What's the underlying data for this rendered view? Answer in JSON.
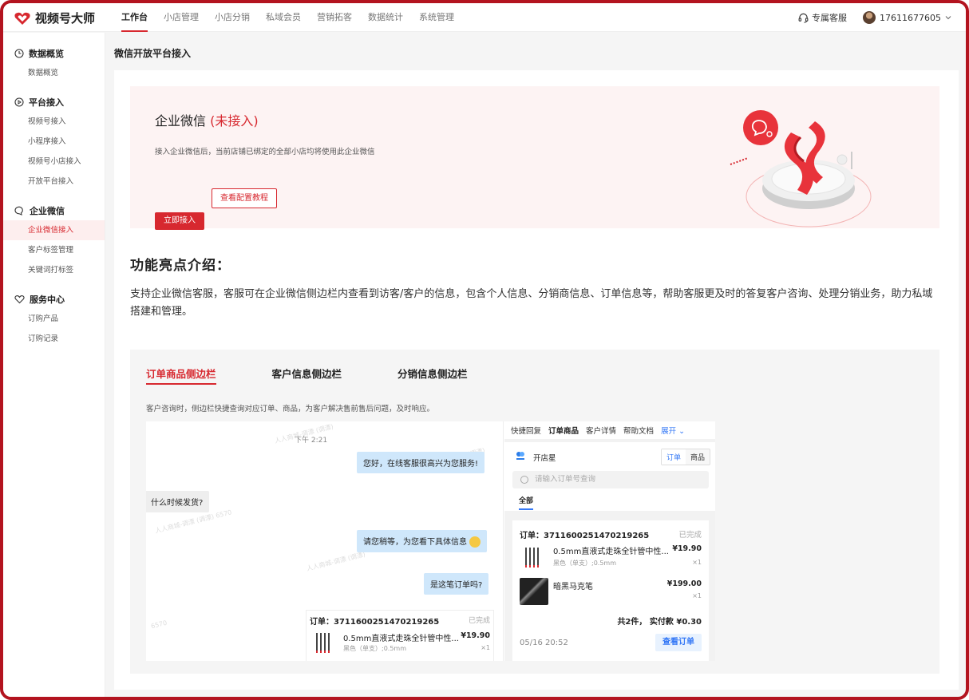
{
  "app": {
    "name": "视频号大师"
  },
  "nav": [
    "工作台",
    "小店管理",
    "小店分销",
    "私域会员",
    "营销拓客",
    "数据统计",
    "系统管理"
  ],
  "top_right": {
    "service": "专属客服",
    "user": "17611677605"
  },
  "sidebar": [
    {
      "title": "数据概览",
      "icon": "clock-icon",
      "items": [
        "数据概览"
      ]
    },
    {
      "title": "平台接入",
      "icon": "play-circle-icon",
      "items": [
        "视频号接入",
        "小程序接入",
        "视频号小店接入",
        "开放平台接入"
      ]
    },
    {
      "title": "企业微信",
      "icon": "chat-bubble-icon",
      "items": [
        "企业微信接入",
        "客户标签管理",
        "关键词打标签"
      ]
    },
    {
      "title": "服务中心",
      "icon": "heart-icon",
      "items": [
        "订购产品",
        "订购记录"
      ]
    }
  ],
  "breadcrumb": "微信开放平台接入",
  "hero": {
    "title": "企业微信",
    "status": "(未接入)",
    "desc": "接入企业微信后，当前店铺已绑定的全部小店均将使用此企业微信",
    "guide_btn": "查看配置教程",
    "apply_btn": "立即接入"
  },
  "features": {
    "title": "功能亮点介绍：",
    "desc": "支持企业微信客服，客服可在企业微信侧边栏内查看到访客/客户的信息，包含个人信息、分销商信息、订单信息等，帮助客服更及时的答复客户咨询、处理分销业务，助力私域搭建和管理。"
  },
  "tabs": [
    "订单商品侧边栏",
    "客户信息侧边栏",
    "分销信息侧边栏"
  ],
  "tab_desc": "客户咨询时，侧边栏快捷查询对应订单、商品，为客户解决售前售后问题，及时响应。",
  "chat": {
    "time": "下午 2:21",
    "msg1": "您好，在线客服很高兴为您服务!",
    "msg2": "什么时候发货?",
    "msg3": "请您稍等，为您看下具体信息",
    "msg4": "是这笔订单吗?",
    "watermark": "人人商城-调漂 (调漂)",
    "watermark2": "人人商城-调漂 (调漂) 6570",
    "watermark3": "6570",
    "order": {
      "no": "订单：3711600251470219265",
      "status": "已完成",
      "name": "0.5mm直液式走珠全针管中性...",
      "spec": "黑色（单支）;0.5mm",
      "price": "¥19.90",
      "qty": "×1"
    }
  },
  "side": {
    "tabs": [
      "快捷回复",
      "订单商品",
      "客户详情",
      "帮助文档"
    ],
    "expand": "展开",
    "shop_name": "开店星",
    "seg": [
      "订单",
      "商品"
    ],
    "search_placeholder": "请输入订单号查询",
    "filter": "全部",
    "order": {
      "no": "订单：3711600251470219265",
      "status": "已完成",
      "item1": {
        "name": "0.5mm直液式走珠全针管中性...",
        "spec": "黑色（单支）;0.5mm",
        "price": "¥19.90",
        "qty": "×1"
      },
      "item2": {
        "name": "暗黑马克笔",
        "price": "¥199.00",
        "qty": "×1"
      },
      "total": "共2件， 实付款 ¥0.30",
      "time": "05/16 20:52",
      "btn": "查看订单"
    }
  },
  "colors": {
    "brand": "#d7282f",
    "link": "#3478f6",
    "frame": "#b3141f"
  }
}
